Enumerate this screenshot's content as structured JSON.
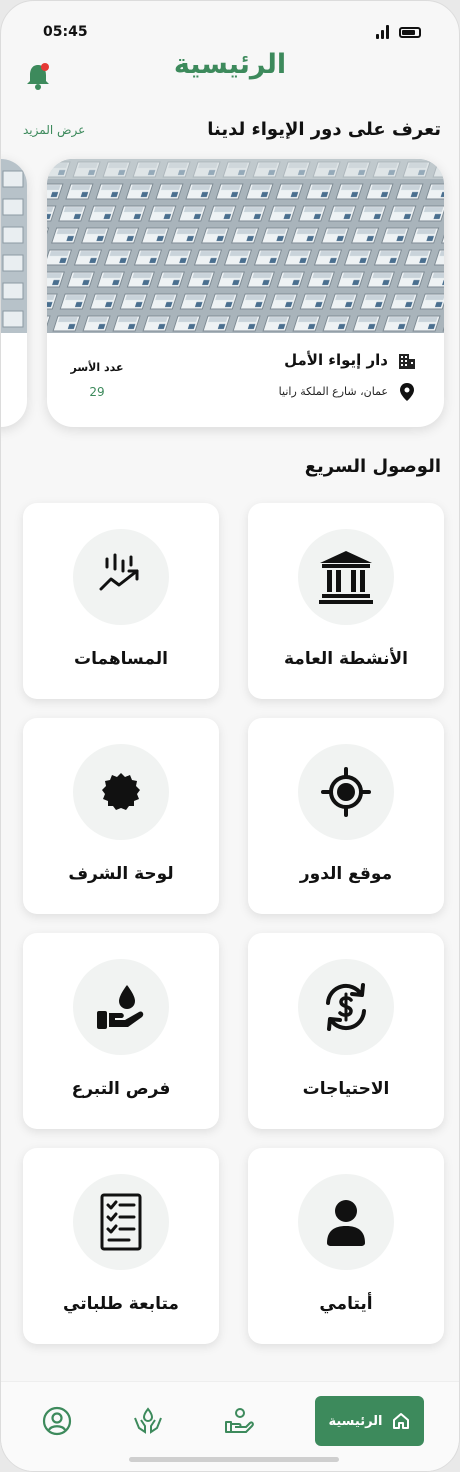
{
  "status_bar": {
    "time": "05:45"
  },
  "header": {
    "title": "الرئيسية"
  },
  "shelters_section": {
    "title": "تعرف على دور الإيواء لدينا",
    "see_more": "عرض المزيد",
    "card": {
      "name": "دار إيواء الأمل",
      "address": "عمان، شارع الملكة رانيا",
      "families_label": "عدد الأسر",
      "families_count": "29"
    }
  },
  "quick_access": {
    "title": "الوصول السريع",
    "items": [
      {
        "label": "الأنشطة العامة",
        "icon": "bank-icon"
      },
      {
        "label": "المساهمات",
        "icon": "chart-trend-icon"
      },
      {
        "label": "موقع الدور",
        "icon": "target-location-icon"
      },
      {
        "label": "لوحة الشرف",
        "icon": "badge-seal-icon"
      },
      {
        "label": "الاحتياجات",
        "icon": "dollar-exchange-icon"
      },
      {
        "label": "فرص التبرع",
        "icon": "donation-hand-icon"
      },
      {
        "label": "أيتامي",
        "icon": "user-icon"
      },
      {
        "label": "متابعة طلباتي",
        "icon": "checklist-icon"
      }
    ]
  },
  "bottom_nav": {
    "home_label": "الرئيسية",
    "items": [
      "profile-icon",
      "care-hands-icon",
      "donate-icon",
      "home-icon"
    ]
  },
  "colors": {
    "accent": "#3d8a5c",
    "background": "#f7f7f7"
  }
}
